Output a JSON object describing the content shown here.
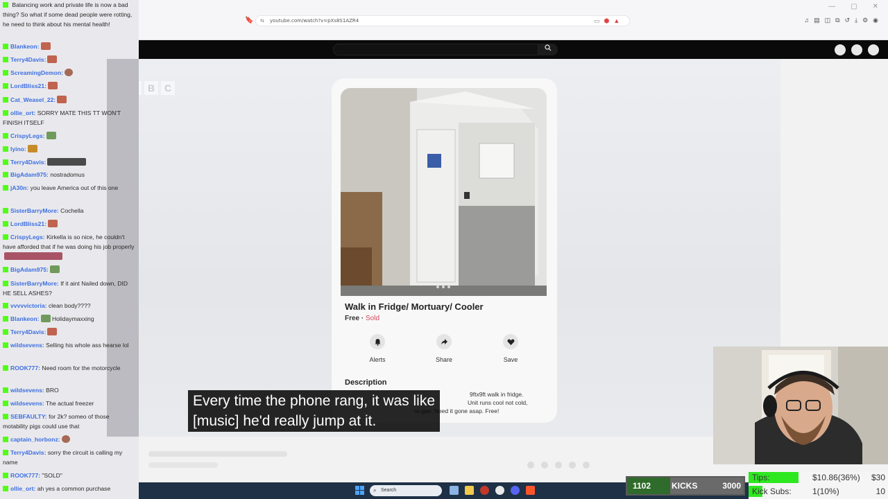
{
  "browser": {
    "url": "youtube.com/watch?v=pXs8S1AZR4"
  },
  "video": {
    "listing": {
      "title": "Walk in Fridge/ Mortuary/ Cooler",
      "price": "Free",
      "separator": " · ",
      "status": "Sold",
      "actions": [
        {
          "label": "Alerts",
          "icon": "bell-icon"
        },
        {
          "label": "Share",
          "icon": "share-icon"
        },
        {
          "label": "Save",
          "icon": "heart-icon"
        }
      ],
      "description_heading": "Description",
      "description_lines": [
        "9ftx9ft walk in fridge.",
        "Unit runs cool not cold,",
        "re-gas. Need it gone asap. Free!"
      ]
    },
    "caption": {
      "line1": "Every time the phone rang, it was like",
      "line2": "[music] he'd really jump at it."
    }
  },
  "chat": {
    "messages": [
      {
        "user": "",
        "text": "Balancing work and private life is now a bad thing? So what if some dead people were rotting, he need to think about his mental health!"
      },
      {
        "user": "Blankeon:",
        "text": ""
      },
      {
        "user": "Terry4Davis:",
        "text": ""
      },
      {
        "user": "ScreamingDemon:",
        "text": ""
      },
      {
        "user": "LordBliss21:",
        "text": ""
      },
      {
        "user": "Cat_Weasel_22:",
        "text": ""
      },
      {
        "user": "ollie_ort:",
        "text": "SORRY MATE THIS TT WON'T FINISH ITSELF"
      },
      {
        "user": "CrispyLegs:",
        "text": ""
      },
      {
        "user": "lyino:",
        "text": ""
      },
      {
        "user": "Terry4Davis:",
        "text": ""
      },
      {
        "user": "BigAdam975:",
        "text": "nostradomus"
      },
      {
        "user": "jA30n:",
        "text": "you leave America out of this one"
      },
      {
        "user": "SisterBarryMore:",
        "text": "Cochella"
      },
      {
        "user": "LordBliss21:",
        "text": ""
      },
      {
        "user": "CrispyLegs:",
        "text": "Kirkella is so nice, he couldn't have afforded that if he was doing his job properly"
      },
      {
        "user": "BigAdam975:",
        "text": ""
      },
      {
        "user": "SisterBarryMore:",
        "text": "If it aint Nailed down, DID HE SELL ASHES?"
      },
      {
        "user": "vvvvvictoria:",
        "text": "clean body????"
      },
      {
        "user": "Blankeon:",
        "text": "Holidaymaxxing"
      },
      {
        "user": "Terry4Davis:",
        "text": ""
      },
      {
        "user": "wildsevens:",
        "text": "Selling his whole ass hearse lol"
      },
      {
        "user": "ROOK777:",
        "text": "Need room for the motorcycle"
      },
      {
        "user": "wildsevens:",
        "text": "BRO"
      },
      {
        "user": "wildsevens:",
        "text": "The actual freezer"
      },
      {
        "user": "SEBFAULTY:",
        "text": "for 2k? someo of those motability pigs could use that"
      },
      {
        "user": "captain_horbonz:",
        "text": ""
      },
      {
        "user": "Terry4Davis:",
        "text": "sorry the circuit is calling my name"
      },
      {
        "user": "ROOK777:",
        "text": "\"SOLD\""
      },
      {
        "user": "ollie_ort:",
        "text": "ah yes a common purchase"
      }
    ]
  },
  "taskbar": {
    "search_placeholder": "Search"
  },
  "kicks_goal": {
    "current": "1102",
    "label": "KICKS",
    "goal": "3000",
    "progress": 0.3673
  },
  "goals": [
    {
      "name": "Tips:",
      "value": "$10.86(36%)",
      "max": "$30",
      "progress": 0.36
    },
    {
      "name": "Kick Subs:",
      "value": "1(10%)",
      "max": "10",
      "progress": 0.1
    }
  ],
  "colors": {
    "kick_green": "#53fc18",
    "sold_red": "#d3485b",
    "username_blue": "#3d6fe0"
  }
}
